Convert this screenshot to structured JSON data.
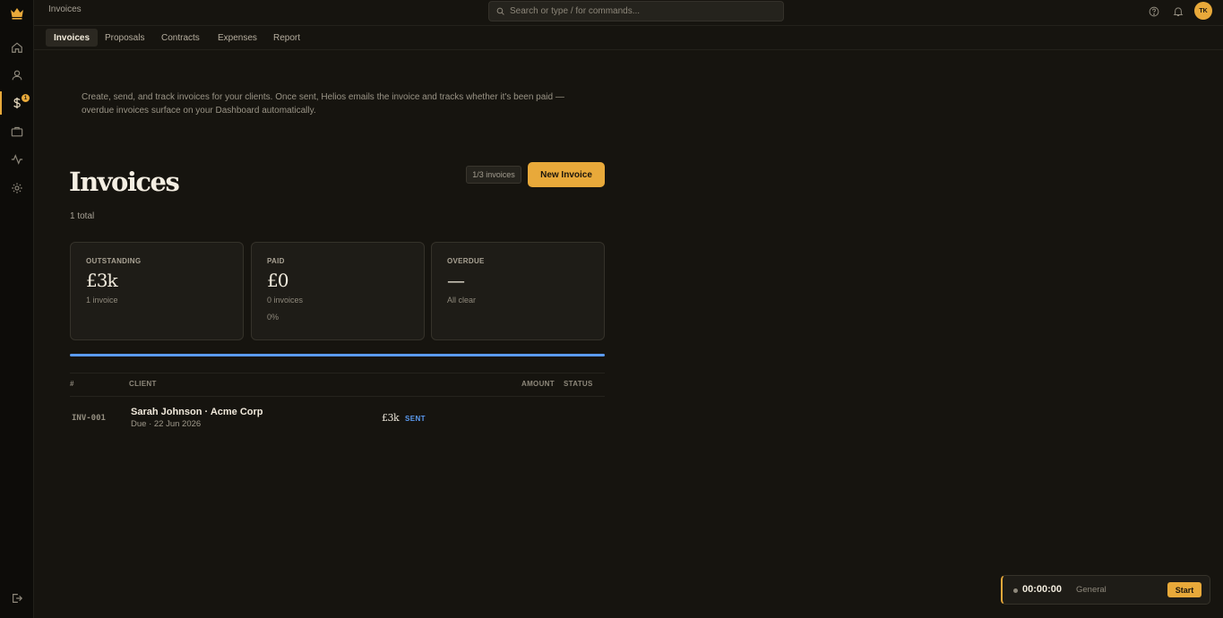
{
  "app": {
    "window_title": "Invoices"
  },
  "search": {
    "placeholder": "Search or type / for commands..."
  },
  "user": {
    "initials": "TK"
  },
  "sidebar": {
    "finance_badge": "1"
  },
  "tabs": [
    {
      "label": "Invoices",
      "active": true
    },
    {
      "label": "Proposals"
    },
    {
      "label": "Contracts"
    },
    {
      "label": "Expenses"
    },
    {
      "label": "Report"
    }
  ],
  "intro": {
    "text": "Create, send, and track invoices for your clients. Once sent, Helios emails the invoice and tracks whether it's been paid — overdue invoices surface on your Dashboard automatically."
  },
  "header": {
    "title": "Invoices",
    "total": "1 total",
    "quota": "1/3 invoices",
    "new_button": "New Invoice"
  },
  "stats": [
    {
      "label": "OUTSTANDING",
      "value": "£3k",
      "sub": "1 invoice"
    },
    {
      "label": "PAID",
      "value": "£0",
      "sub": "0 invoices",
      "sub2": "0%"
    },
    {
      "label": "OVERDUE",
      "value": "—",
      "sub": "All clear"
    }
  ],
  "progress": {
    "value_percent": 100
  },
  "table": {
    "headers": {
      "num": "#",
      "client": "CLIENT",
      "amount": "AMOUNT",
      "status": "STATUS"
    },
    "rows": [
      {
        "num": "INV-001",
        "client": "Sarah Johnson · Acme Corp",
        "due": "Due · 22 Jun 2026",
        "amount": "£3k",
        "status": "SENT"
      }
    ]
  },
  "timer": {
    "time": "00:00:00",
    "label": "General",
    "start": "Start"
  },
  "colors": {
    "accent": "#e8a93a",
    "status_sent": "#5b9bf2",
    "background": "#16140f"
  },
  "icons": [
    "crown-icon",
    "home-icon",
    "user-icon",
    "dollar-icon",
    "briefcase-icon",
    "activity-icon",
    "gear-icon",
    "logout-icon",
    "search-icon",
    "help-icon",
    "bell-icon"
  ]
}
